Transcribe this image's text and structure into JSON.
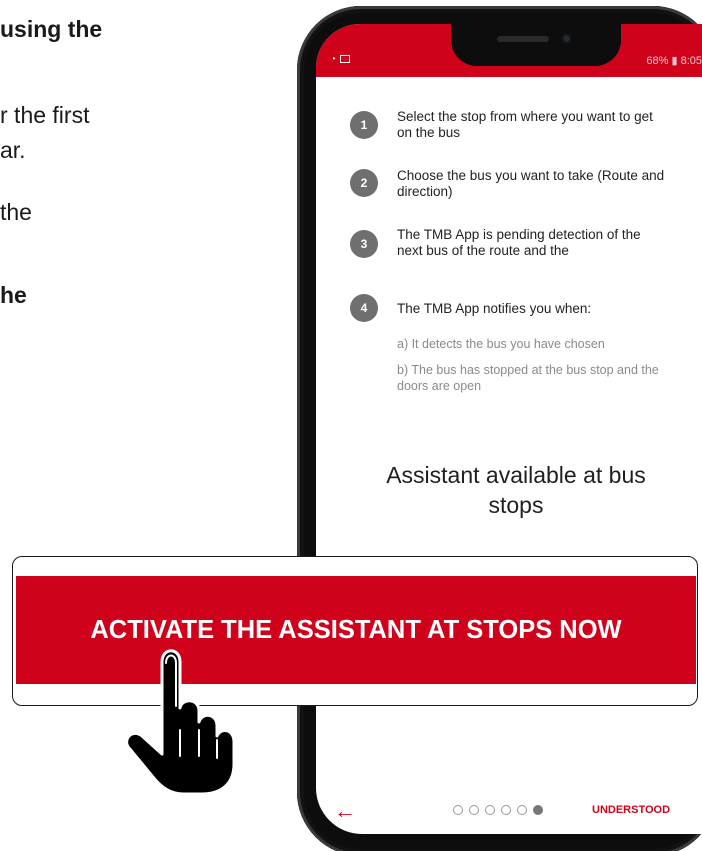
{
  "left_column": {
    "line1": "using the",
    "line2": "r the first",
    "line3": "ar.",
    "line4": " the",
    "line5": "he"
  },
  "status_bar": {
    "right": "68% ▮ 8:05"
  },
  "steps": [
    {
      "number": "1",
      "text": "Select the stop from where you want to get on the bus"
    },
    {
      "number": "2",
      "text": "Choose the bus you want to take (Route and direction)"
    },
    {
      "number": "3",
      "text": "The TMB App is pending detection of the next bus of the route and the"
    },
    {
      "number": "4",
      "text": "The TMB App notifies you when:"
    }
  ],
  "sub_items": [
    "a) It detects the bus you have chosen",
    "b) The bus has stopped at the bus stop and the doors are open"
  ],
  "assistant_title": "Assistant available at bus stops",
  "callout": {
    "label": "ACTIVATE THE ASSISTANT AT STOPS NOW"
  },
  "bottom_nav": {
    "back_arrow": "←",
    "understood_label": "UNDERSTOOD",
    "page_count": 6,
    "active_page": 6
  },
  "colors": {
    "brand_red": "#d0021b",
    "step_badge": "#6f6f6f"
  }
}
